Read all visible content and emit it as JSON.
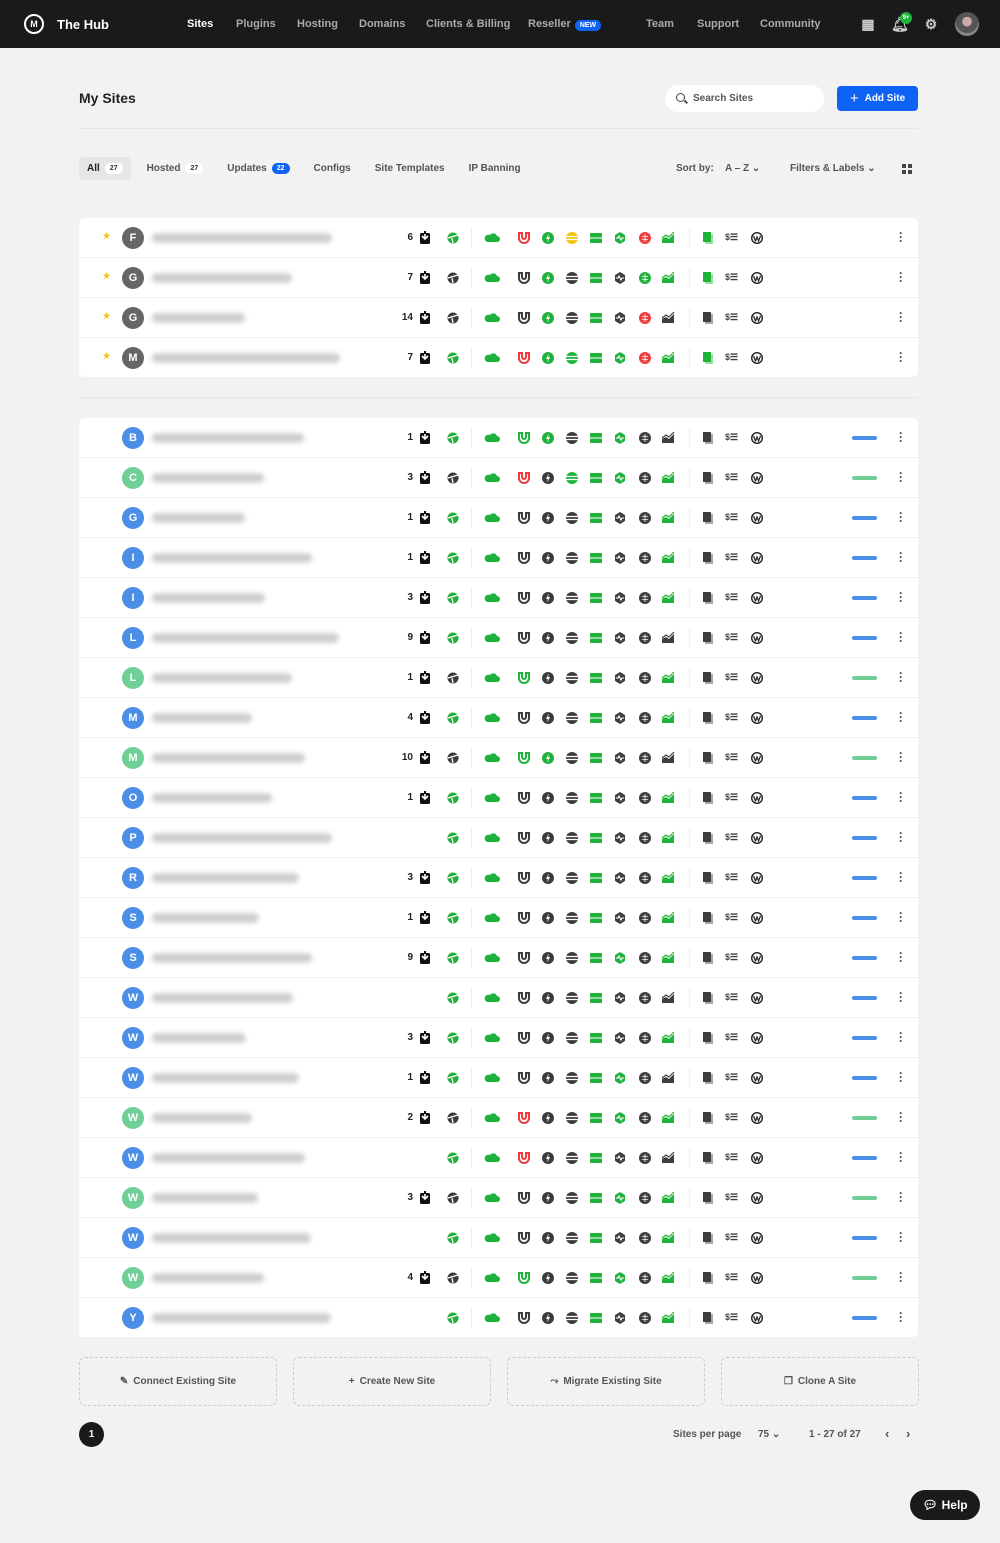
{
  "header": {
    "brand": "The Hub",
    "nav": [
      {
        "label": "Sites",
        "active": true
      },
      {
        "label": "Plugins"
      },
      {
        "label": "Hosting"
      },
      {
        "label": "Domains"
      },
      {
        "label": "Clients & Billing"
      },
      {
        "label": "Reseller",
        "badge": "NEW"
      },
      {
        "label": "Team"
      },
      {
        "label": "Support"
      },
      {
        "label": "Community"
      }
    ],
    "notification_badge": "9+"
  },
  "page": {
    "title": "My Sites",
    "search_placeholder": "Search Sites",
    "add_site": "Add Site"
  },
  "tabs": [
    {
      "label": "All",
      "count": "27",
      "active": true
    },
    {
      "label": "Hosted",
      "count": "27"
    },
    {
      "label": "Updates",
      "count": "22",
      "highlight": true
    },
    {
      "label": "Configs"
    },
    {
      "label": "Site Templates"
    },
    {
      "label": "IP Banning"
    }
  ],
  "sort": {
    "label": "Sort by:",
    "value": "A – Z",
    "filters": "Filters & Labels"
  },
  "colors": {
    "g": "#1fb33c",
    "k": "#3d3d3d",
    "r": "#ef3b3b",
    "y": "#f4c20d",
    "blue": "#0e63f4",
    "label_blue": "#4a8ee6",
    "label_green": "#6fcf97",
    "avatar_gray": "#666666"
  },
  "favorites": [
    {
      "letter": "F",
      "updates": "6",
      "states": "grgygrgg"
    },
    {
      "letter": "G",
      "updates": "7",
      "states": "kkgkkggg"
    },
    {
      "letter": "G",
      "updates": "14",
      "states": "kkgkkrkk"
    },
    {
      "letter": "M",
      "updates": "7",
      "states": "grgggrgg"
    }
  ],
  "sites": [
    {
      "letter": "B",
      "updates": "1",
      "states": "gggkgkkk",
      "label": "blue"
    },
    {
      "letter": "C",
      "updates": "3",
      "states": "krkggkgk",
      "label": "green"
    },
    {
      "letter": "G",
      "updates": "1",
      "states": "gkkkkkgk",
      "label": "blue"
    },
    {
      "letter": "I",
      "updates": "1",
      "states": "gkkkkkgk",
      "label": "blue"
    },
    {
      "letter": "I",
      "updates": "3",
      "states": "gkkkkkgk",
      "label": "blue"
    },
    {
      "letter": "L",
      "updates": "9",
      "states": "gkkkkkkk",
      "label": "blue"
    },
    {
      "letter": "L",
      "updates": "1",
      "states": "kgkkkkgk",
      "label": "green"
    },
    {
      "letter": "M",
      "updates": "4",
      "states": "gkkkkkgk",
      "label": "blue"
    },
    {
      "letter": "M",
      "updates": "10",
      "states": "kggkkkkk",
      "label": "green"
    },
    {
      "letter": "O",
      "updates": "1",
      "states": "gkkkkkgk",
      "label": "blue"
    },
    {
      "letter": "P",
      "updates": "",
      "states": "gkkkkkgk",
      "label": "blue"
    },
    {
      "letter": "R",
      "updates": "3",
      "states": "gkkkkkgk",
      "label": "blue"
    },
    {
      "letter": "S",
      "updates": "1",
      "states": "gkkkkkgk",
      "label": "blue"
    },
    {
      "letter": "S",
      "updates": "9",
      "states": "gkkkgkgk",
      "label": "blue"
    },
    {
      "letter": "W",
      "updates": "",
      "states": "gkkkkkkk",
      "label": "blue"
    },
    {
      "letter": "W",
      "updates": "3",
      "states": "gkkkkkgk",
      "label": "blue"
    },
    {
      "letter": "W",
      "updates": "1",
      "states": "gkkkgkkk",
      "label": "blue"
    },
    {
      "letter": "W",
      "updates": "2",
      "states": "krkkgkgk",
      "label": "green"
    },
    {
      "letter": "W",
      "updates": "",
      "states": "grkkkkkk",
      "label": "blue"
    },
    {
      "letter": "W",
      "updates": "3",
      "states": "kkkkgkgk",
      "label": "green"
    },
    {
      "letter": "W",
      "updates": "",
      "states": "gkkkkkgk",
      "label": "blue"
    },
    {
      "letter": "W",
      "updates": "4",
      "states": "kgkkgkgk",
      "label": "green"
    },
    {
      "letter": "Y",
      "updates": "",
      "states": "gkkkkkgk",
      "label": "blue"
    }
  ],
  "actions": [
    "Connect Existing Site",
    "Create New Site",
    "Migrate Existing Site",
    "Clone A Site"
  ],
  "pagination": {
    "current": "1",
    "per_page_label": "Sites per page",
    "per_page": "75",
    "range": "1 - 27 of 27"
  },
  "help": "Help"
}
